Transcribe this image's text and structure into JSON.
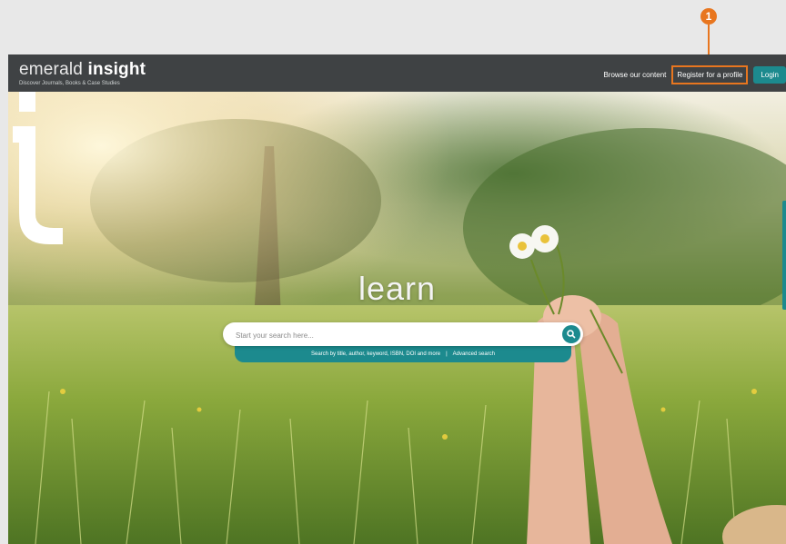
{
  "annotation": {
    "badge": "1"
  },
  "header": {
    "logo_light": "emerald",
    "logo_bold": "insight",
    "tagline": "Discover Journals, Books & Case Studies",
    "nav": {
      "browse": "Browse our content",
      "register": "Register for a profile",
      "login": "Login"
    }
  },
  "hero": {
    "word": "learn",
    "search": {
      "placeholder": "Start your search here...",
      "help": "Search by title, author, keyword, ISBN, DOI and more",
      "separator": "|",
      "advanced": "Advanced search"
    }
  },
  "colors": {
    "accent": "#1c8a8e",
    "callout": "#e8761f",
    "topbar": "#3f4244"
  },
  "icons": {
    "search": "search-icon",
    "brand_mark": "emerald-i-icon"
  }
}
